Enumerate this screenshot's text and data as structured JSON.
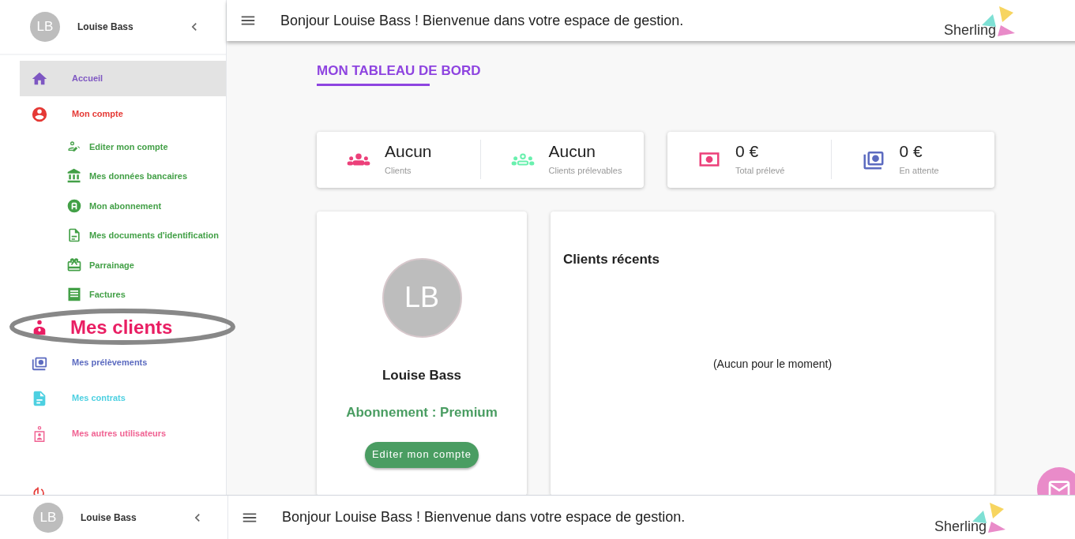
{
  "user": {
    "initials": "LB",
    "name": "Louise Bass"
  },
  "header": {
    "greeting": "Bonjour Louise Bass ! Bienvenue dans votre espace de gestion.",
    "logo": "Sherling"
  },
  "nav": [
    {
      "label": "Accueil",
      "kind": "home",
      "color": "#7e57c2",
      "selected": true,
      "circled": false
    },
    {
      "label": "Mon compte",
      "kind": "account",
      "color": "#e53935",
      "selected": false,
      "circled": false,
      "children": [
        {
          "label": "Editer mon compte",
          "kind": "edit-user",
          "color": "#43a047",
          "selected": false
        },
        {
          "label": "Mes données bancaires",
          "kind": "bank",
          "color": "#43a047",
          "selected": false
        },
        {
          "label": "Mon abonnement",
          "kind": "badge",
          "color": "#43a047",
          "selected": false
        },
        {
          "label": "Mes documents d'identification",
          "kind": "doc",
          "color": "#43a047",
          "selected": false
        },
        {
          "label": "Parrainage",
          "kind": "gift",
          "color": "#43a047",
          "selected": false
        },
        {
          "label": "Factures",
          "kind": "receipt",
          "color": "#43a047",
          "selected": false
        }
      ]
    },
    {
      "label": "Mes clients",
      "kind": "client",
      "color": "#e91e63",
      "selected": false,
      "circled": true
    },
    {
      "label": "Mes prélèvements",
      "kind": "money-stack",
      "color": "#5c6bc0",
      "selected": false,
      "circled": false
    },
    {
      "label": "Mes contrats",
      "kind": "doc-fill",
      "color": "#4dd0e1",
      "selected": false,
      "circled": false
    },
    {
      "label": "Mes autres utilisateurs",
      "kind": "user-outline",
      "color": "#f06292",
      "selected": false,
      "circled": false
    }
  ],
  "page_title": "MON TABLEAU DE BORD",
  "stat_cards": [
    {
      "stats": [
        {
          "value": "Aucun",
          "label": "Clients",
          "kind": "group",
          "color": "#ec407a"
        },
        {
          "value": "Aucun",
          "label": "Clients prélevables",
          "kind": "group-outline",
          "color": "#69f0ae"
        }
      ]
    },
    {
      "stats": [
        {
          "value": "0 €",
          "label": "Total prélevé",
          "kind": "money",
          "color": "#ec407a"
        },
        {
          "value": "0 €",
          "label": "En attente",
          "kind": "money-stack",
          "color": "#5c6bc0"
        }
      ]
    }
  ],
  "profile_card": {
    "initials": "LB",
    "name": "Louise Bass",
    "subscription": "Abonnement : Premium",
    "button": "Editer mon compte"
  },
  "recent_clients": {
    "title": "Clients récents",
    "empty": "(Aucun pour le moment)"
  },
  "bottom_bar": {
    "initials": "LB",
    "name": "Louise Bass",
    "greeting": "Bonjour Louise Bass ! Bienvenue dans votre espace de gestion.",
    "logo": "Sherling"
  }
}
